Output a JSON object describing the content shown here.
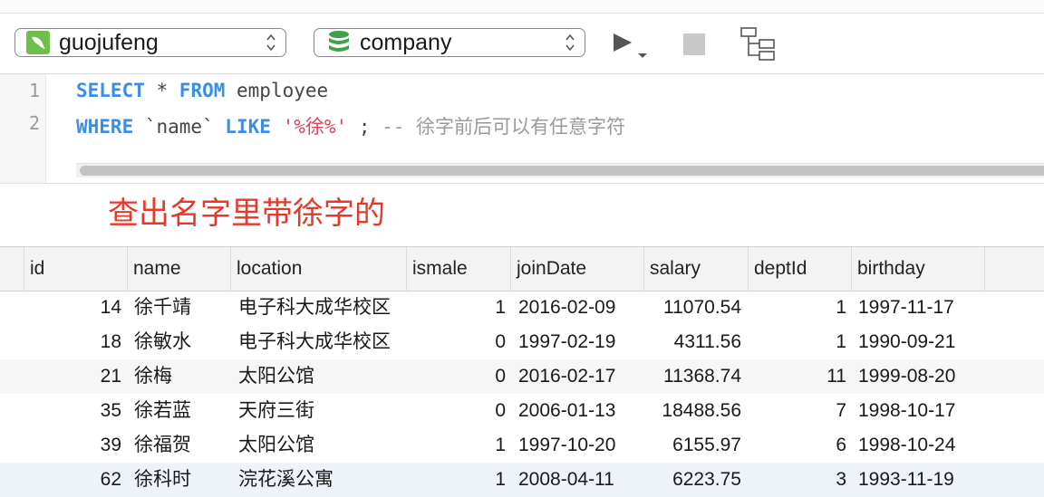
{
  "toolbar": {
    "connection": "guojufeng",
    "database": "company",
    "run_icon": "play-icon",
    "stop_icon": "stop-icon",
    "explain_icon": "tree-structure-icon"
  },
  "editor": {
    "line_numbers": [
      "1",
      "2"
    ],
    "line1": {
      "kw1": "SELECT",
      "op": " * ",
      "kw2": "FROM",
      "rest": " employee"
    },
    "line2": {
      "kw1": "WHERE",
      "field": " `name` ",
      "kw2": "LIKE",
      "sp": " ",
      "str": "'%徐%'",
      "semi": " ; ",
      "comment": "-- 徐字前后可以有任意字符"
    }
  },
  "annotation": "查出名字里带徐字的",
  "grid": {
    "columns": [
      "id",
      "name",
      "location",
      "ismale",
      "joinDate",
      "salary",
      "deptId",
      "birthday"
    ],
    "rows": [
      [
        "14",
        "徐千靖",
        "电子科大成华校区",
        "1",
        "2016-02-09",
        "11070.54",
        "1",
        "1997-11-17"
      ],
      [
        "18",
        "徐敏水",
        "电子科大成华校区",
        "0",
        "1997-02-19",
        "4311.56",
        "1",
        "1990-09-21"
      ],
      [
        "21",
        "徐梅",
        "太阳公馆",
        "0",
        "2016-02-17",
        "11368.74",
        "11",
        "1999-08-20"
      ],
      [
        "35",
        "徐若蓝",
        "天府三街",
        "0",
        "2006-01-13",
        "18488.56",
        "7",
        "1998-10-17"
      ],
      [
        "39",
        "徐福贺",
        "太阳公馆",
        "1",
        "1997-10-20",
        "6155.97",
        "6",
        "1998-10-24"
      ],
      [
        "62",
        "徐科时",
        "浣花溪公寓",
        "1",
        "2008-04-11",
        "6223.75",
        "3",
        "1993-11-19"
      ]
    ]
  },
  "colors": {
    "keyword": "#3a8ee6",
    "string": "#d6455b",
    "comment": "#9a9a9a",
    "annotation": "#e53a2a"
  }
}
